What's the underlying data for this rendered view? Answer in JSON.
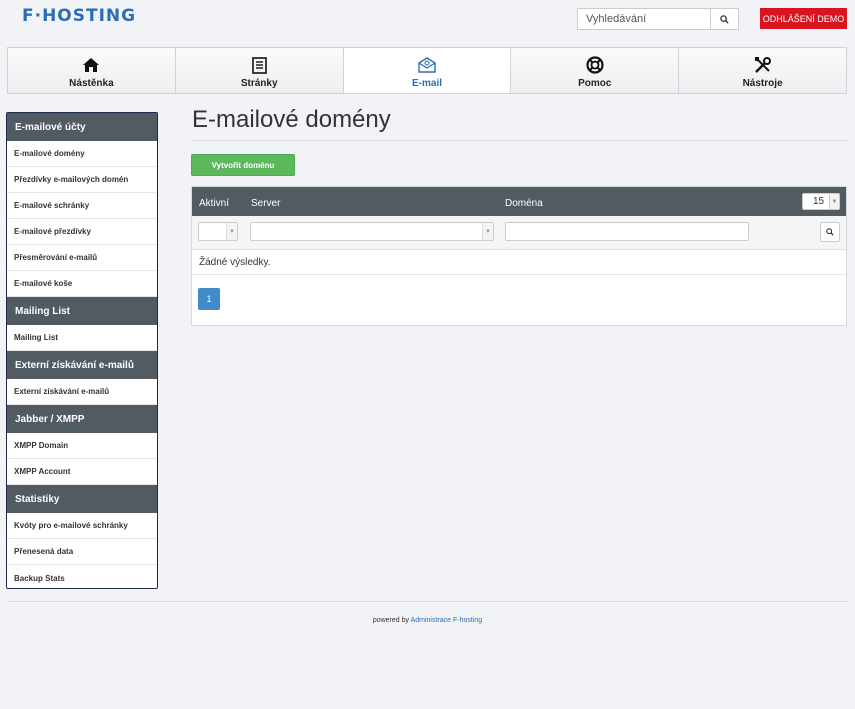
{
  "header": {
    "logo_text": "F·HOSTING",
    "search_placeholder": "Vyhledávání",
    "logout_label": "ODHLÁŠENÍ DEMO"
  },
  "nav": {
    "tabs": [
      {
        "label": "Nástěnka",
        "icon": "home-icon",
        "active": false
      },
      {
        "label": "Stránky",
        "icon": "page-icon",
        "active": false
      },
      {
        "label": "E-mail",
        "icon": "email-icon",
        "active": true
      },
      {
        "label": "Pomoc",
        "icon": "lifebuoy-icon",
        "active": false
      },
      {
        "label": "Nástroje",
        "icon": "tools-icon",
        "active": false
      }
    ]
  },
  "sidebar": {
    "sections": [
      {
        "title": "E-mailové účty",
        "items": [
          "E-mailové domény",
          "Přezdívky e-mailových domén",
          "E-mailové schránky",
          "E-mailové přezdívky",
          "Přesměrování e-mailů",
          "E-mailové koše"
        ]
      },
      {
        "title": "Mailing List",
        "items": [
          "Mailing List"
        ]
      },
      {
        "title": "Externí získávání e-mailů",
        "items": [
          "Externí získávání e-mailů"
        ]
      },
      {
        "title": "Jabber / XMPP",
        "items": [
          "XMPP Domain",
          "XMPP Account"
        ]
      },
      {
        "title": "Statistiky",
        "items": [
          "Kvóty pro e-mailové schránky",
          "Přenesená data",
          "Backup Stats"
        ]
      }
    ]
  },
  "main": {
    "title": "E-mailové domény",
    "create_label": "Vytvořit doménu",
    "table": {
      "columns": [
        "Aktivní",
        "Server",
        "Doména"
      ],
      "page_size": "15",
      "no_results": "Žádné výsledky.",
      "current_page": "1"
    }
  },
  "footer": {
    "prefix": "powered by",
    "link": "Administrace F-hosting"
  },
  "colors": {
    "accent": "#2d6db5",
    "logout": "#d9141e",
    "header_dark": "#525a62",
    "create": "#5cb85c",
    "pager": "#428bca"
  }
}
